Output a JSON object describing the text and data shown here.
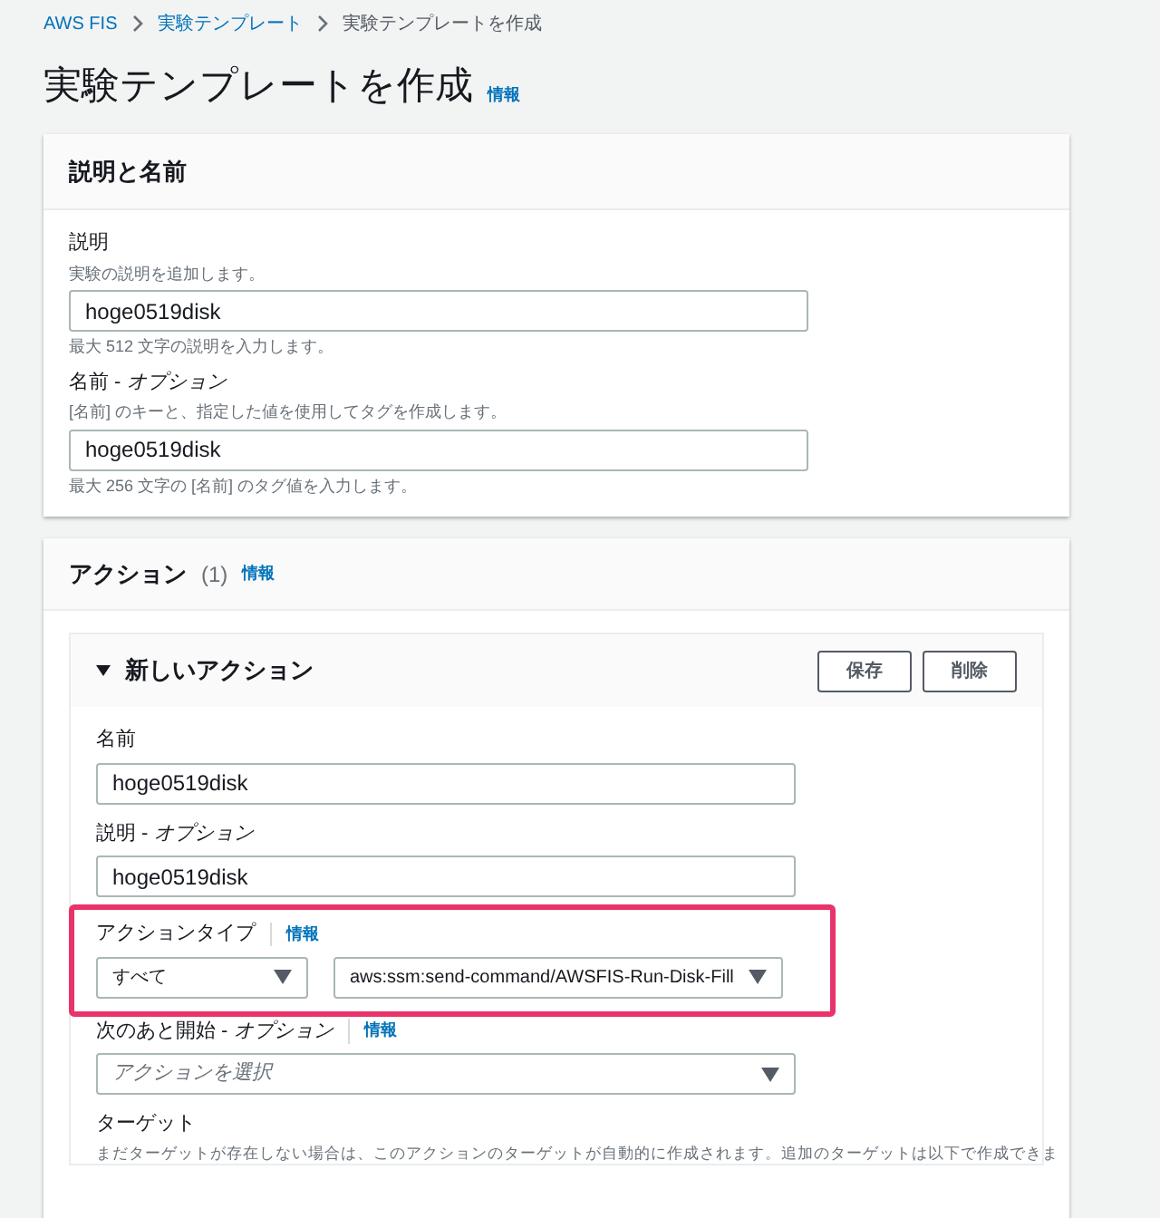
{
  "breadcrumb": [
    {
      "label": "AWS FIS",
      "kind": "link"
    },
    {
      "label": "実験テンプレート",
      "kind": "link"
    },
    {
      "label": "実験テンプレートを作成",
      "kind": "current"
    }
  ],
  "page_title": "実験テンプレートを作成",
  "page_info": "情報",
  "description_section": {
    "title": "説明と名前",
    "fields": [
      {
        "label": "説明",
        "hint": "実験の説明を追加します。",
        "value": "hoge0519disk",
        "constraint": "最大 512 文字の説明を入力します。"
      },
      {
        "label": "名前 - *オプション*",
        "hint": "[名前] のキーと、指定した値を使用してタグを作成します。",
        "value": "hoge0519disk",
        "constraint": "最大 256 文字の [名前] のタグ値を入力します。"
      }
    ]
  },
  "actions_section": {
    "title": "アクション",
    "count": "(1)",
    "info": "情報",
    "action": {
      "title": "新しいアクション",
      "expanded": true,
      "buttons": [
        "保存",
        "削除"
      ],
      "name": {
        "label": "名前",
        "value": "hoge0519disk"
      },
      "description": {
        "label": "説明 - *オプション*",
        "value": "hoge0519disk"
      },
      "action_type": {
        "label": "アクションタイプ",
        "info": "情報",
        "highlighted": true,
        "category": "すべて",
        "value": "aws:ssm:send-command/AWSFIS-Run-Disk-Fill"
      },
      "start_after": {
        "label": "次のあと開始 - *オプション*",
        "info": "情報",
        "placeholder": "アクションを選択"
      },
      "target": {
        "label": "ターゲット",
        "hint": "まだターゲットが存在しない場合は、このアクションのターゲットが自動的に作成されます。追加のターゲットは以下で作成できま"
      }
    }
  }
}
